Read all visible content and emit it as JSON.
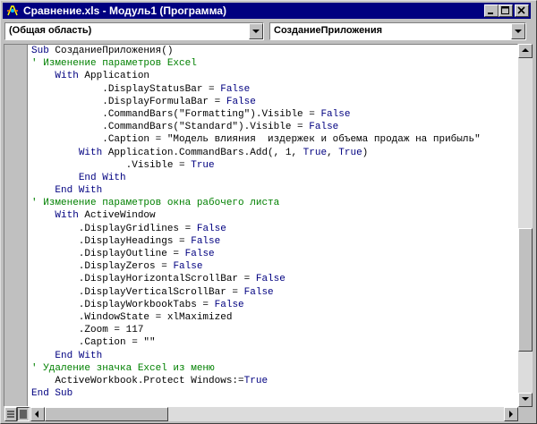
{
  "window": {
    "title": "Сравнение.xls - Модуль1 (Программа)"
  },
  "object_combo": {
    "value": "(Общая область)"
  },
  "procedure_combo": {
    "value": "СозданиеПриложения"
  },
  "code_lines": [
    {
      "segments": [
        {
          "t": "kw",
          "text": "Sub"
        },
        {
          "t": "n",
          "text": " СозданиеПриложения()"
        }
      ]
    },
    {
      "segments": [
        {
          "t": "cm",
          "text": "' Изменение параметров Excel"
        }
      ]
    },
    {
      "segments": [
        {
          "t": "n",
          "text": "    "
        },
        {
          "t": "kw",
          "text": "With"
        },
        {
          "t": "n",
          "text": " Application"
        }
      ]
    },
    {
      "segments": [
        {
          "t": "n",
          "text": "            .DisplayStatusBar = "
        },
        {
          "t": "kw",
          "text": "False"
        }
      ]
    },
    {
      "segments": [
        {
          "t": "n",
          "text": "            .DisplayFormulaBar = "
        },
        {
          "t": "kw",
          "text": "False"
        }
      ]
    },
    {
      "segments": [
        {
          "t": "n",
          "text": "            .CommandBars(\"Formatting\").Visible = "
        },
        {
          "t": "kw",
          "text": "False"
        }
      ]
    },
    {
      "segments": [
        {
          "t": "n",
          "text": "            .CommandBars(\"Standard\").Visible = "
        },
        {
          "t": "kw",
          "text": "False"
        }
      ]
    },
    {
      "segments": [
        {
          "t": "n",
          "text": "            .Caption = \"Модель влияния  издержек и объема продаж на прибыль\""
        }
      ]
    },
    {
      "segments": [
        {
          "t": "n",
          "text": "        "
        },
        {
          "t": "kw",
          "text": "With"
        },
        {
          "t": "n",
          "text": " Application.CommandBars.Add(, 1, "
        },
        {
          "t": "kw",
          "text": "True"
        },
        {
          "t": "n",
          "text": ", "
        },
        {
          "t": "kw",
          "text": "True"
        },
        {
          "t": "n",
          "text": ")"
        }
      ]
    },
    {
      "segments": [
        {
          "t": "n",
          "text": "                .Visible = "
        },
        {
          "t": "kw",
          "text": "True"
        }
      ]
    },
    {
      "segments": [
        {
          "t": "n",
          "text": "        "
        },
        {
          "t": "kw",
          "text": "End With"
        }
      ]
    },
    {
      "segments": [
        {
          "t": "n",
          "text": "    "
        },
        {
          "t": "kw",
          "text": "End With"
        }
      ]
    },
    {
      "segments": [
        {
          "t": "cm",
          "text": "' Изменение параметров окна рабочего листа"
        }
      ]
    },
    {
      "segments": [
        {
          "t": "n",
          "text": "    "
        },
        {
          "t": "kw",
          "text": "With"
        },
        {
          "t": "n",
          "text": " ActiveWindow"
        }
      ]
    },
    {
      "segments": [
        {
          "t": "n",
          "text": "        .DisplayGridlines = "
        },
        {
          "t": "kw",
          "text": "False"
        }
      ]
    },
    {
      "segments": [
        {
          "t": "n",
          "text": "        .DisplayHeadings = "
        },
        {
          "t": "kw",
          "text": "False"
        }
      ]
    },
    {
      "segments": [
        {
          "t": "n",
          "text": "        .DisplayOutline = "
        },
        {
          "t": "kw",
          "text": "False"
        }
      ]
    },
    {
      "segments": [
        {
          "t": "n",
          "text": "        .DisplayZeros = "
        },
        {
          "t": "kw",
          "text": "False"
        }
      ]
    },
    {
      "segments": [
        {
          "t": "n",
          "text": "        .DisplayHorizontalScrollBar = "
        },
        {
          "t": "kw",
          "text": "False"
        }
      ]
    },
    {
      "segments": [
        {
          "t": "n",
          "text": "        .DisplayVerticalScrollBar = "
        },
        {
          "t": "kw",
          "text": "False"
        }
      ]
    },
    {
      "segments": [
        {
          "t": "n",
          "text": "        .DisplayWorkbookTabs = "
        },
        {
          "t": "kw",
          "text": "False"
        }
      ]
    },
    {
      "segments": [
        {
          "t": "n",
          "text": "        .WindowState = xlMaximized"
        }
      ]
    },
    {
      "segments": [
        {
          "t": "n",
          "text": "        .Zoom = 117"
        }
      ]
    },
    {
      "segments": [
        {
          "t": "n",
          "text": "        .Caption = \"\""
        }
      ]
    },
    {
      "segments": [
        {
          "t": "n",
          "text": "    "
        },
        {
          "t": "kw",
          "text": "End With"
        }
      ]
    },
    {
      "segments": [
        {
          "t": "cm",
          "text": "' Удаление значка Excel из меню"
        }
      ]
    },
    {
      "segments": [
        {
          "t": "n",
          "text": "    ActiveWorkbook.Protect Windows:="
        },
        {
          "t": "kw",
          "text": "True"
        }
      ]
    },
    {
      "segments": [
        {
          "t": "kw",
          "text": "End Sub"
        }
      ]
    }
  ]
}
